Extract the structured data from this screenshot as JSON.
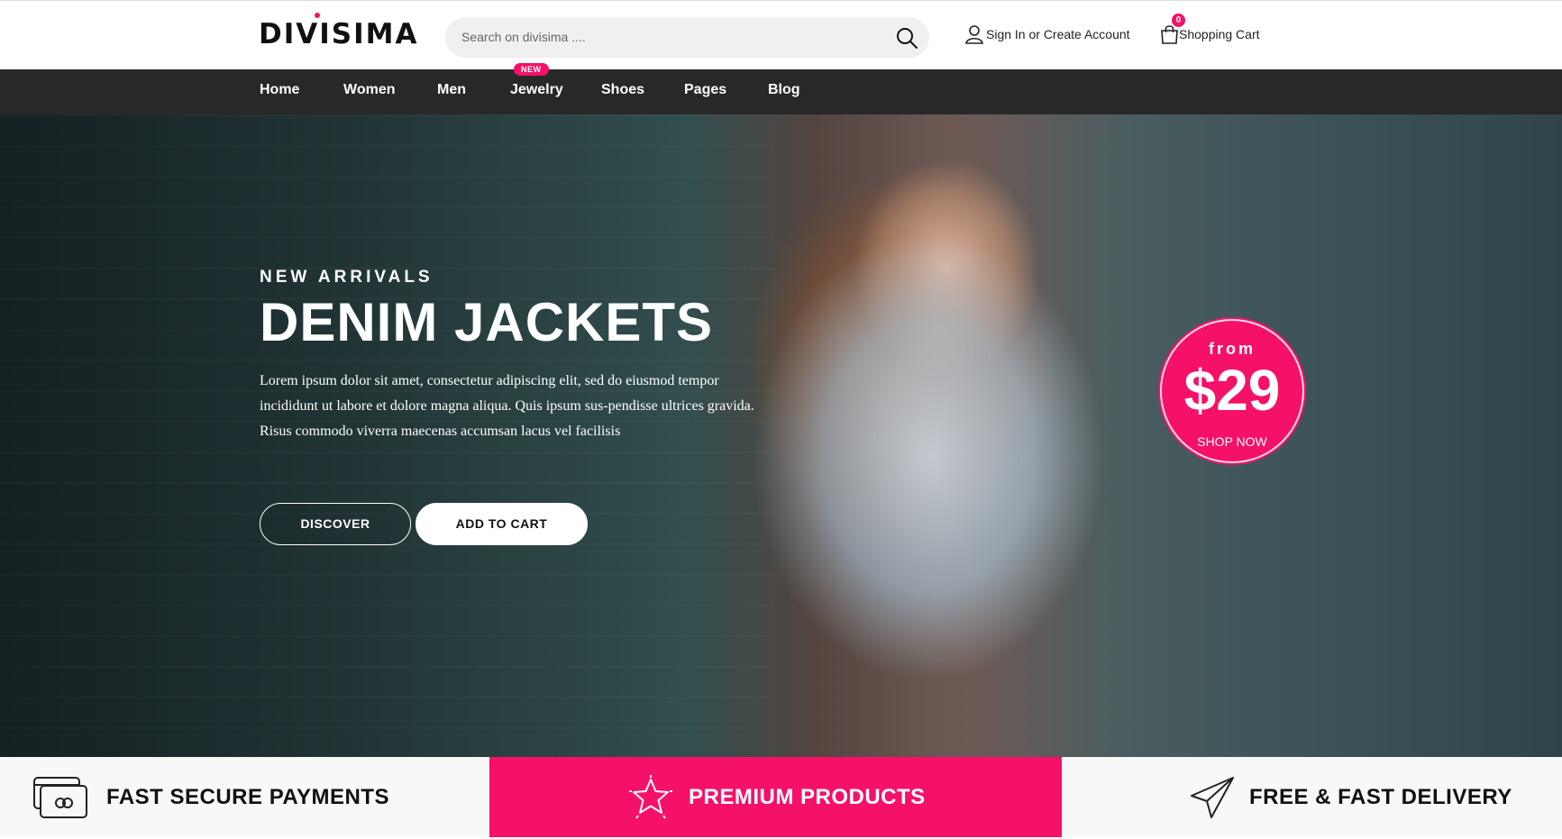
{
  "header": {
    "logo": "DIVISIMA",
    "search_placeholder": "Search on divisima ....",
    "account_label": "Sign In or Create Account",
    "cart_label": "Shopping Cart",
    "cart_count": "0"
  },
  "nav": {
    "items": [
      {
        "label": "Home"
      },
      {
        "label": "Women"
      },
      {
        "label": "Men"
      },
      {
        "label": "Jewelry",
        "badge": "NEW"
      },
      {
        "label": "Shoes"
      },
      {
        "label": "Pages"
      },
      {
        "label": "Blog"
      }
    ]
  },
  "hero": {
    "eyebrow": "NEW ARRIVALS",
    "title": "DENIM JACKETS",
    "description": "Lorem ipsum dolor sit amet, consectetur adipiscing elit, sed do eiusmod tempor incididunt ut labore et dolore magna aliqua. Quis ipsum sus-pendisse ultrices gravida. Risus commodo viverra maecenas accumsan lacus vel facilisis",
    "discover_label": "DISCOVER",
    "add_to_cart_label": "ADD TO CART",
    "price_from": "from",
    "price": "$29",
    "shop_now": "SHOP NOW"
  },
  "features": [
    {
      "label": "FAST SECURE PAYMENTS",
      "icon": "payment-card-icon"
    },
    {
      "label": "PREMIUM PRODUCTS",
      "icon": "star-icon"
    },
    {
      "label": "FREE & FAST DELIVERY",
      "icon": "paper-plane-icon"
    }
  ],
  "colors": {
    "accent": "#f51167",
    "nav_bg": "#282828",
    "feature_bg": "#f8f8f8"
  }
}
